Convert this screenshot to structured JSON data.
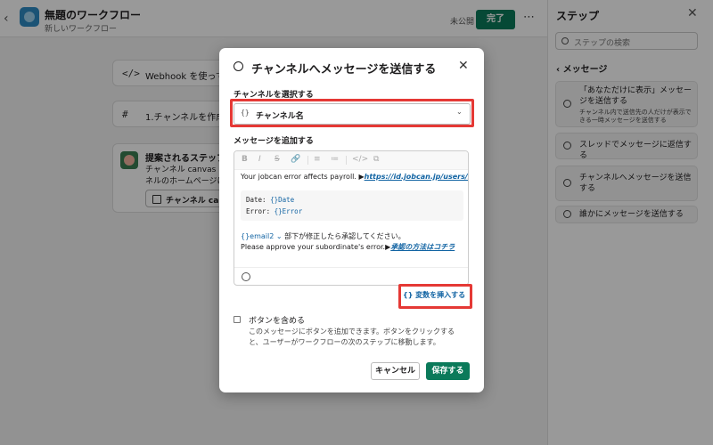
{
  "header": {
    "title": "無題のワークフロー",
    "subtitle": "新しいワークフロー",
    "status": "未公開",
    "done_label": "完了",
    "back_glyph": "‹",
    "more_glyph": "⋯"
  },
  "canvas": {
    "steps": [
      {
        "icon": "</>",
        "label": "Webhook を使って開始"
      },
      {
        "icon": "#",
        "label": "1.チャンネルを作成す"
      }
    ],
    "suggestion": {
      "title": "提案されるステップ",
      "desc_line1": "チャンネル canvas を",
      "desc_line2": "ネルのホームページに",
      "button_label": "チャンネル canvas"
    }
  },
  "sidebar": {
    "title": "ステップ",
    "close_glyph": "✕",
    "search_placeholder": "ステップの検索",
    "back_label": "‹ メッセージ",
    "items": [
      {
        "title": "「あなただけに表示」メッセージを送信する",
        "desc": "チャンネル内で送信先の人だけが表示できる一時メッセージを送信する"
      },
      {
        "title": "スレッドでメッセージに返信する",
        "desc": ""
      },
      {
        "title": "チャンネルへメッセージを送信する",
        "desc": ""
      },
      {
        "title": "誰かにメッセージを送信する",
        "desc": ""
      }
    ]
  },
  "modal": {
    "title": "チャンネルへメッセージを送信する",
    "close_glyph": "✕",
    "channel_label": "チャンネルを選択する",
    "channel_value": "チャンネル名",
    "channel_brace": "{}",
    "message_label": "メッセージを追加する",
    "toolbar": [
      "B",
      "I",
      "S",
      "🔗",
      "≡",
      "≔",
      "</>",
      "⧉"
    ],
    "message": {
      "line1_text": "Your jobcan error affects payroll. ▶",
      "line1_link": "https://id.jobcan.jp/users/sign_in",
      "code_row1_label": "Date: ",
      "code_row1_token": "{}Date",
      "code_row2_label": "Error: ",
      "code_row2_token": "{}Error",
      "line3_token": "{}email2 ⌄",
      "line3_text": " 部下が修正したら承認してください。",
      "line4_text": "Please approve your subordinate's error.▶",
      "line4_link": "承認の方法はコチラ"
    },
    "insert_variable_label": "{} 変数を挿入する",
    "include_button_label": "ボタンを含める",
    "include_button_desc1": "このメッセージにボタンを追加できます。ボタンをクリックする",
    "include_button_desc2": "と、ユーザーがワークフローの次のステップに移動します。",
    "cancel_label": "キャンセル",
    "save_label": "保存する"
  }
}
